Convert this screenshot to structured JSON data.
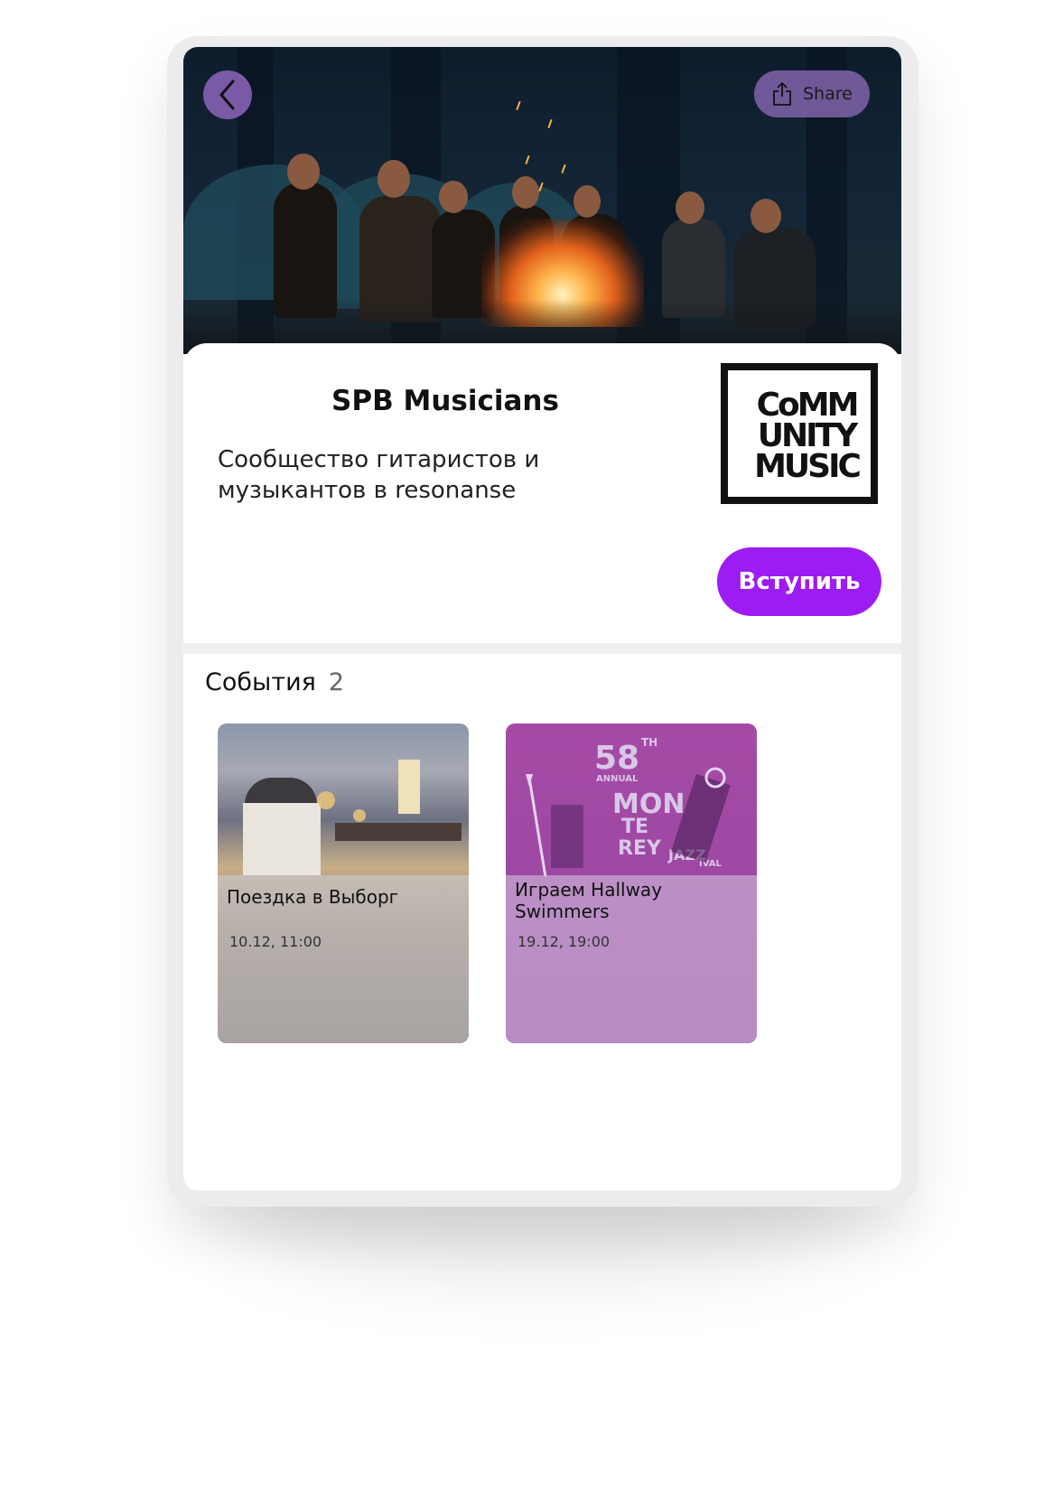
{
  "header": {
    "share_label": "Share"
  },
  "community": {
    "title": "SPB Musicians",
    "description": "Сообщество гитаристов и музыкантов в resonanse",
    "logo_lines": [
      "CoMM",
      "UNITY",
      "MUSIC"
    ],
    "join_label": "Вступить"
  },
  "events": {
    "heading": "События",
    "count": "2",
    "items": [
      {
        "title": "Поездка в Выборг",
        "date": "10.12, 11:00"
      },
      {
        "title": "Играем Hallway Swimmers",
        "date": "19.12, 19:00"
      }
    ],
    "poster_text": [
      "58",
      "TH",
      "ANNUAL",
      "MON",
      "TE",
      "REY",
      "JAZZ",
      "IVAL"
    ]
  },
  "colors": {
    "accent": "#9d1cf3",
    "back_button": "#7a5aa6",
    "share_button": "#8064aa"
  },
  "icons": [
    "chevron-left-icon",
    "share-icon"
  ]
}
